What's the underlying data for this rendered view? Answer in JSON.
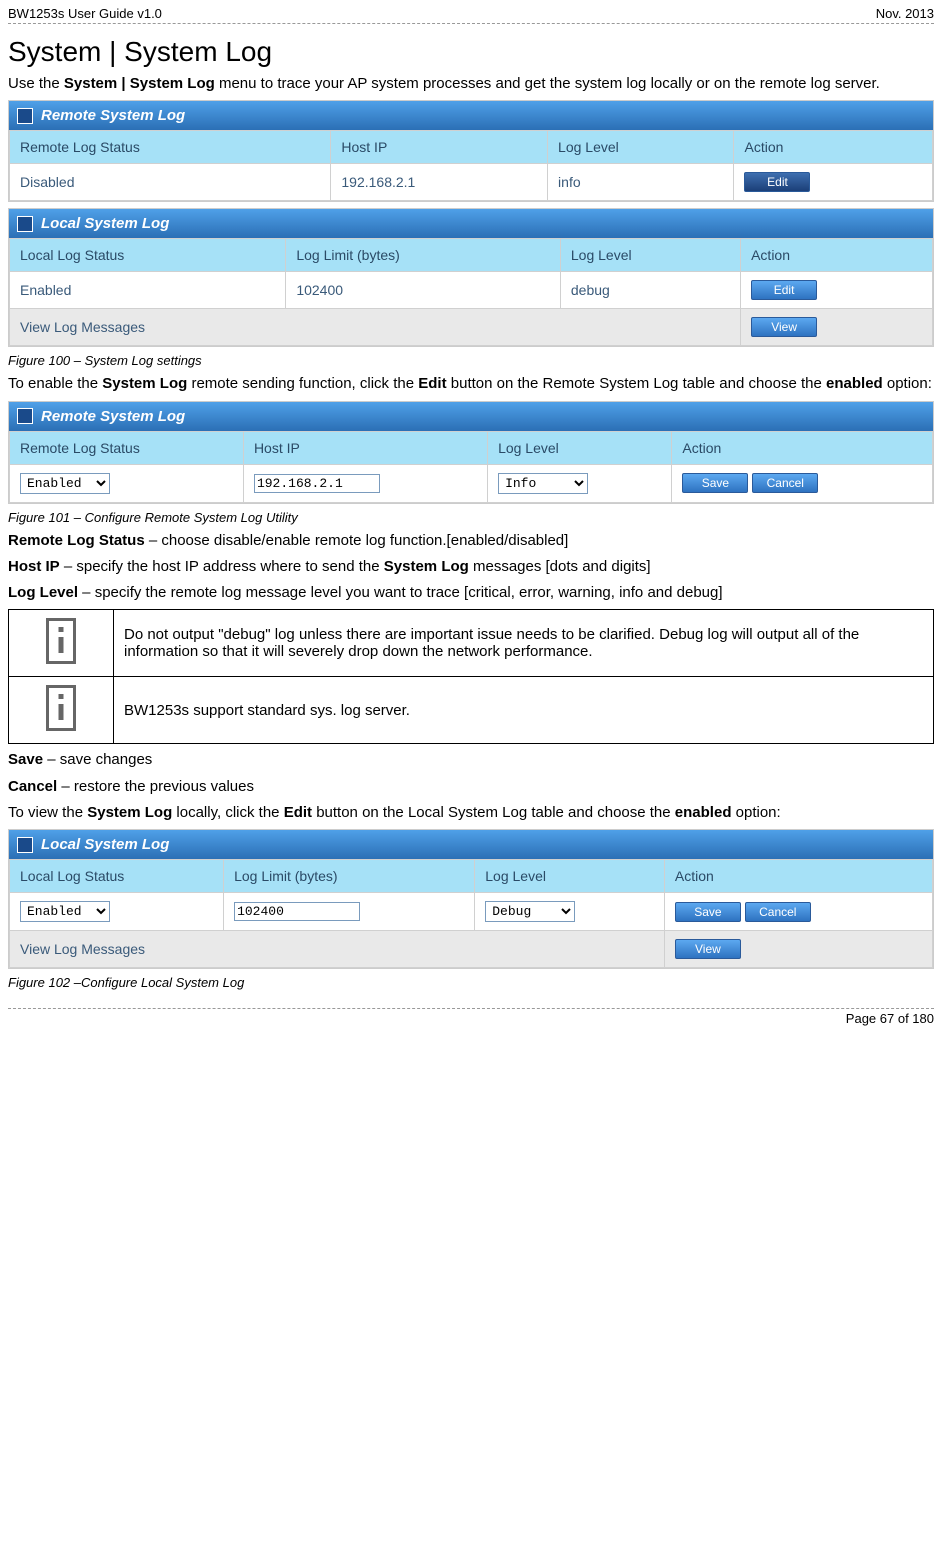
{
  "doc": {
    "header_left": "BW1253s User Guide v1.0",
    "header_right": "Nov.  2013",
    "section_title": "System | System Log",
    "intro_before": "Use the ",
    "intro_bold": "System | System Log",
    "intro_after": " menu to trace your AP system processes and get the system log locally or on the remote log server.",
    "fig100": "Figure 100 – System Log settings",
    "para_enable_before": "To enable the ",
    "para_enable_b1": "System Log",
    "para_enable_mid1": " remote sending function, click the ",
    "para_enable_b2": "Edit",
    "para_enable_mid2": " button on the Remote System Log table and choose the ",
    "para_enable_b3": "enabled",
    "para_enable_after": " option:",
    "fig101": "Figure 101 – Configure Remote System Log Utility",
    "rls_label": "Remote Log Status",
    "rls_desc": " – choose disable/enable remote log function.[enabled/disabled]",
    "hostip_label": "Host IP",
    "hostip_desc_before": " – specify the host IP address where to send the ",
    "hostip_desc_bold": "System Log",
    "hostip_desc_after": " messages [dots and digits]",
    "loglevel_label": "Log Level",
    "loglevel_desc": " – specify the remote log message level you want to trace [critical, error, warning, info and debug]",
    "note1": "Do not output \"debug\" log unless there are important issue needs to be clarified. Debug log will output all of the information so that it will severely drop down the network performance.",
    "note2": "BW1253s support standard sys. log server.",
    "save_label": "Save",
    "save_desc": " – save changes",
    "cancel_label": "Cancel",
    "cancel_desc": " – restore the previous values",
    "viewlocal_before": "To view the ",
    "viewlocal_b1": "System Log",
    "viewlocal_mid1": " locally, click the ",
    "viewlocal_b2": "Edit",
    "viewlocal_mid2": " button on the Local System Log table and choose the ",
    "viewlocal_b3": "enabled",
    "viewlocal_after": " option:",
    "fig102": "Figure 102 –Configure Local System Log",
    "footer": "Page 67 of 180"
  },
  "remote_panel": {
    "title": "Remote System Log",
    "cols": [
      "Remote Log Status",
      "Host IP",
      "Log Level",
      "Action"
    ],
    "row": {
      "status": "Disabled",
      "host": "192.168.2.1",
      "level": "info"
    }
  },
  "local_panel": {
    "title": "Local System Log",
    "cols": [
      "Local Log Status",
      "Log Limit (bytes)",
      "Log Level",
      "Action"
    ],
    "row": {
      "status": "Enabled",
      "limit": "102400",
      "level": "debug"
    },
    "viewmsg": "View Log Messages"
  },
  "remote_edit": {
    "title": "Remote System Log",
    "cols": [
      "Remote Log Status",
      "Host IP",
      "Log Level",
      "Action"
    ],
    "status_value": "Enabled",
    "host_value": "192.168.2.1",
    "level_value": "Info"
  },
  "local_edit": {
    "title": "Local System Log",
    "cols": [
      "Local Log Status",
      "Log Limit (bytes)",
      "Log Level",
      "Action"
    ],
    "status_value": "Enabled",
    "limit_value": "102400",
    "level_value": "Debug",
    "viewmsg": "View Log Messages"
  },
  "buttons": {
    "edit": "Edit",
    "view": "View",
    "save": "Save",
    "cancel": "Cancel"
  }
}
